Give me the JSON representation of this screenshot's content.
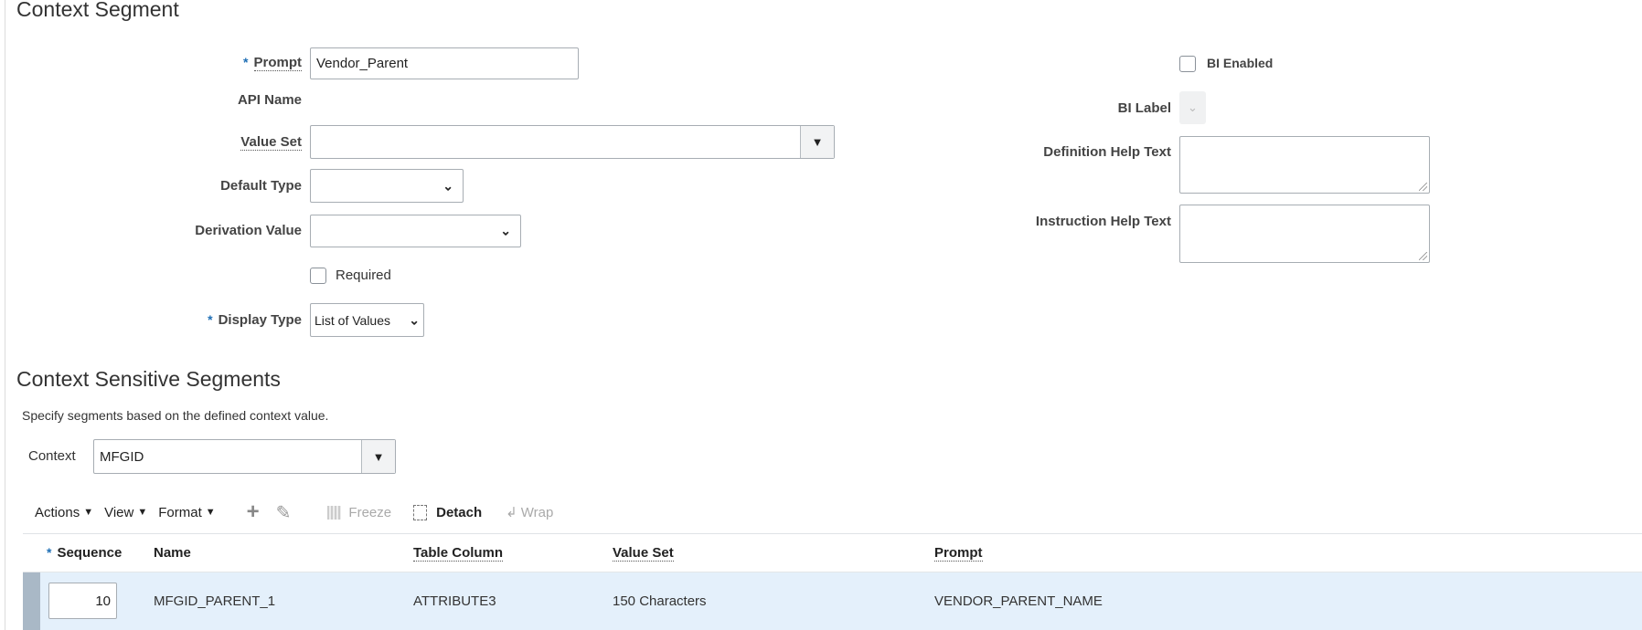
{
  "context_segment": {
    "title": "Context Segment",
    "prompt": {
      "label": "Prompt",
      "required_mark": "*",
      "value": "Vendor_Parent"
    },
    "api_name": {
      "label": "API Name"
    },
    "value_set": {
      "label": "Value Set",
      "value": ""
    },
    "default_type": {
      "label": "Default Type",
      "value": ""
    },
    "derivation_value": {
      "label": "Derivation Value",
      "value": ""
    },
    "required": {
      "label": "Required",
      "checked": false
    },
    "display_type": {
      "label": "Display Type",
      "required_mark": "*",
      "value": "List of Values"
    },
    "bi_enabled": {
      "label": "BI Enabled",
      "checked": false
    },
    "bi_label": {
      "label": "BI Label"
    },
    "definition_help_text": {
      "label": "Definition Help Text",
      "value": ""
    },
    "instruction_help_text": {
      "label": "Instruction Help Text",
      "value": ""
    }
  },
  "context_sensitive": {
    "title": "Context Sensitive Segments",
    "description": "Specify segments based on the defined context value.",
    "context": {
      "label": "Context",
      "value": "MFGID"
    },
    "toolbar": {
      "actions": "Actions",
      "view": "View",
      "format": "Format",
      "freeze": "Freeze",
      "detach": "Detach",
      "wrap": "Wrap"
    },
    "table": {
      "required_mark": "*",
      "columns": [
        "Sequence",
        "Name",
        "Table Column",
        "Value Set",
        "Prompt"
      ],
      "rows": [
        {
          "sequence": "10",
          "name": "MFGID_PARENT_1",
          "table_column": "ATTRIBUTE3",
          "value_set": "150 Characters",
          "prompt": "VENDOR_PARENT_NAME"
        }
      ]
    }
  },
  "colors": {
    "accent": "#1f6fb5",
    "selected_row": "#e4f0fb",
    "row_gutter": "#a9b8c6"
  }
}
